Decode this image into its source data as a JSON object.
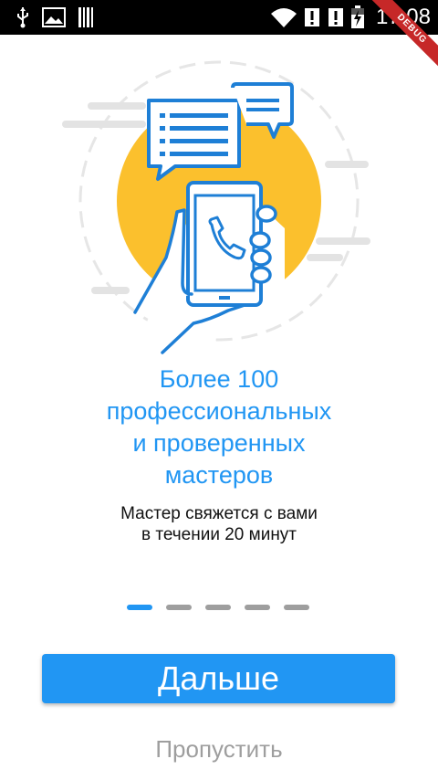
{
  "status_bar": {
    "time": "17:08",
    "icons": [
      "usb-icon",
      "image-icon",
      "barcode-icon",
      "wifi-icon",
      "alert-icon",
      "alert-icon",
      "battery-charging-icon"
    ]
  },
  "debug_banner": "DEBUG",
  "onboarding": {
    "headline_lines": [
      "Более 100",
      "профессиональных",
      "и проверенных",
      "мастеров"
    ],
    "subtitle_lines": [
      "Мастер свяжется с вами",
      "в течении 20 минут"
    ],
    "pages_total": 5,
    "page_active": 1
  },
  "actions": {
    "next_label": "Дальше",
    "skip_label": "Пропустить"
  },
  "colors": {
    "accent": "#2196f3",
    "sun": "#fbc02d",
    "muted": "#9e9e9e"
  }
}
